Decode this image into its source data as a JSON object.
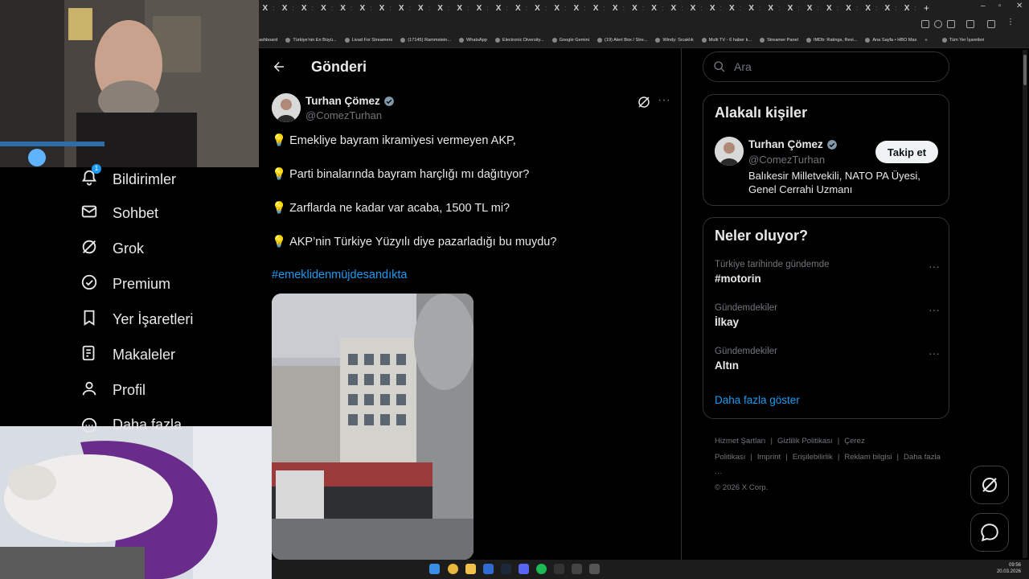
{
  "browser": {
    "tab_label": "X",
    "tab_count": 34,
    "new_tab": "+",
    "bookmarks": [
      "ashboard",
      "Türkiye'nin En Büyü...",
      "Livad For Streamers",
      "(17145) Rammstein...",
      "WhatsApp",
      "Electronic Diversity...",
      "Google Gemini",
      "(19) Alert Box / Stre...",
      "Windy: Sıcaklık",
      "Multi TV - 6 haber k...",
      "Streamer Panel",
      "IMDb: Ratings, Revi...",
      "Ana Sayfa • HBO Max",
      "Tüm Yer İşaretleri"
    ],
    "bookmarks_more": "»"
  },
  "nav": {
    "items": [
      {
        "label": "Bildirimler",
        "icon": "bell-icon",
        "badge": "1"
      },
      {
        "label": "Sohbet",
        "icon": "mail-icon"
      },
      {
        "label": "Grok",
        "icon": "grok-icon"
      },
      {
        "label": "Premium",
        "icon": "verified-icon"
      },
      {
        "label": "Yer İşaretleri",
        "icon": "bookmark-icon"
      },
      {
        "label": "Makaleler",
        "icon": "article-icon"
      },
      {
        "label": "Profil",
        "icon": "person-icon"
      },
      {
        "label": "Daha fazla",
        "icon": "more-circle-icon"
      }
    ]
  },
  "post": {
    "page_title": "Gönderi",
    "author_name": "Turhan Çömez",
    "author_handle": "@ComezTurhan",
    "lines": [
      "Emekliye bayram ikramiyesi vermeyen AKP,",
      "Parti binalarında bayram harçlığı mı dağıtıyor?",
      "Zarflarda ne kadar var acaba, 1500 TL mi?",
      "AKP’nin Türkiye Yüzyılı diye pazarladığı bu muydu?"
    ],
    "bullet": "💡",
    "hashtag": "#emeklidenmüjdesandıkta"
  },
  "search": {
    "placeholder": "Ara"
  },
  "related": {
    "title": "Alakalı kişiler",
    "name": "Turhan Çömez",
    "handle": "@ComezTurhan",
    "bio": "Balıkesir Milletvekili, NATO PA Üyesi, Genel Cerrahi Uzmanı",
    "follow_label": "Takip et"
  },
  "trends": {
    "title": "Neler oluyor?",
    "items": [
      {
        "context": "Türkiye tarihinde gündemde",
        "name": "#motorin"
      },
      {
        "context": "Gündemdekiler",
        "name": "İlkay"
      },
      {
        "context": "Gündemdekiler",
        "name": "Altın"
      }
    ],
    "show_more": "Daha fazla göster"
  },
  "footer": {
    "links": [
      "Hizmet Şartları",
      "|",
      "Gizlilik Politikası",
      "|",
      "Çerez Politikası",
      "|",
      "Imprint",
      "|",
      "Erişilebilirlik",
      "|",
      "Reklam bilgisi",
      "|",
      "Daha fazla ···"
    ],
    "copyright": "© 2026 X Corp."
  },
  "taskbar": {
    "time": "09:56",
    "date": "20.03.2026"
  },
  "colors": {
    "accent": "#1d9bf0",
    "background": "#000000",
    "border": "#2f3336",
    "muted": "#71767b"
  }
}
